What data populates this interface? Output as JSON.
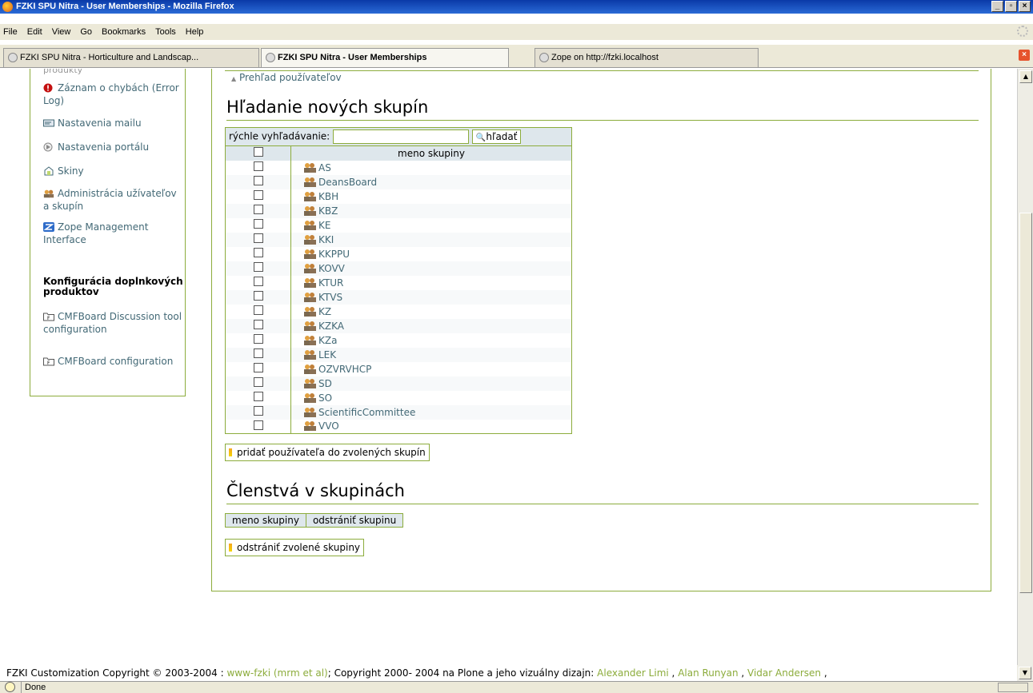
{
  "window": {
    "title": "FZKI SPU Nitra - User Memberships - Mozilla Firefox",
    "controls": [
      "_",
      "▫",
      "×"
    ]
  },
  "menu": [
    "File",
    "Edit",
    "View",
    "Go",
    "Bookmarks",
    "Tools",
    "Help"
  ],
  "tabs": [
    {
      "label": "FZKI SPU Nitra - Horticulture and Landscap..."
    },
    {
      "label": "FZKI SPU Nitra - User Memberships"
    },
    {
      "label": "Zope on http://fzki.localhost"
    }
  ],
  "sidebar": {
    "cut_item": "produkty",
    "items": [
      {
        "label": "Záznam o chybách (Error Log)",
        "icon": "error-icon"
      },
      {
        "label": "Nastavenia mailu",
        "icon": "mail-icon"
      },
      {
        "label": "Nastavenia portálu",
        "icon": "portal-icon"
      },
      {
        "label": "Skiny",
        "icon": "skins-icon"
      },
      {
        "label": "Administrácia užívateľov a skupín",
        "icon": "users-icon"
      },
      {
        "label": "Zope Management Interface",
        "icon": "zope-icon"
      }
    ],
    "heading": "Konfigurácia doplnkových produktov",
    "product_items": [
      {
        "label": "CMFBoard Discussion tool configuration"
      },
      {
        "label": "CMFBoard configuration"
      }
    ]
  },
  "main": {
    "back_link": "Prehľad používateľov",
    "search_heading": "Hľadanie nových skupín",
    "quick_search_label": "rýchle vyhľadávanie:",
    "search_value": "",
    "search_button": "hľadať",
    "column_name": "meno skupiny",
    "groups": [
      "AS",
      "DeansBoard",
      "KBH",
      "KBZ",
      "KE",
      "KKI",
      "KKPPU",
      "KOVV",
      "KTUR",
      "KTVS",
      "KZ",
      "KZKA",
      "KZa",
      "LEK",
      "OZVRVHCP",
      "SD",
      "SO",
      "ScientificCommittee",
      "VVO"
    ],
    "add_button": "pridať používateľa do zvolených skupín",
    "memberships_heading": "Členstvá v skupinách",
    "memb_col_name": "meno skupiny",
    "memb_col_remove": "odstrániť skupinu",
    "remove_button": "odstrániť zvolené skupiny"
  },
  "footer": {
    "part1": "FZKI Customization Copyright © 2003-2004 : ",
    "link1": "www-fzki (mrm et al)",
    "part2": "; Copyright 2000- 2004 na Plone a jeho vizuálny dizajn: ",
    "link2": "Alexander Limi",
    "sep1": " , ",
    "link3": "Alan Runyan",
    "sep2": " , ",
    "link4": "Vidar Andersen",
    "sep3": " ,"
  },
  "status": {
    "text": "Done"
  },
  "colors": {
    "accent": "#8cac3c",
    "link": "#436976",
    "header_bg": "#dee7ec"
  }
}
